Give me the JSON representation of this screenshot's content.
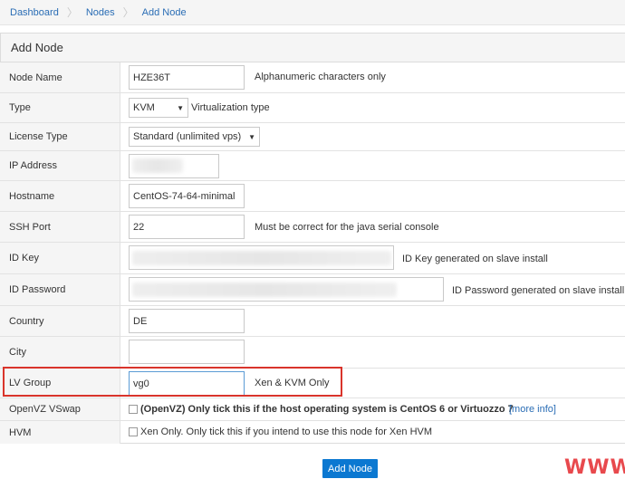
{
  "breadcrumb": [
    "Dashboard",
    "Nodes",
    "Add Node"
  ],
  "panel_title": "Add Node",
  "fields": {
    "node_name": {
      "label": "Node Name",
      "value": "HZE36T",
      "hint": "Alphanumeric characters only"
    },
    "type": {
      "label": "Type",
      "value": "KVM",
      "hint": "Virtualization type"
    },
    "license_type": {
      "label": "License Type",
      "value": "Standard (unlimited vps)"
    },
    "ip_address": {
      "label": "IP Address",
      "value": ""
    },
    "hostname": {
      "label": "Hostname",
      "value": "CentOS-74-64-minimal"
    },
    "ssh_port": {
      "label": "SSH Port",
      "value": "22",
      "hint": "Must be correct for the java serial console"
    },
    "id_key": {
      "label": "ID Key",
      "value": "",
      "hint": "ID Key generated on slave install"
    },
    "id_password": {
      "label": "ID Password",
      "value": "",
      "hint": "ID Password generated on slave install"
    },
    "country": {
      "label": "Country",
      "value": "DE"
    },
    "city": {
      "label": "City",
      "value": ""
    },
    "lv_group": {
      "label": "LV Group",
      "value": "vg0",
      "hint": "Xen & KVM Only"
    },
    "openvz_vswap": {
      "label": "OpenVZ VSwap",
      "text": "(OpenVZ) Only tick this if the host operating system is CentOS 6 or Virtuozzo 7",
      "link": "[more info]"
    },
    "hvm": {
      "label": "HVM",
      "text": "Xen Only. Only tick this if you intend to use this node for Xen HVM"
    }
  },
  "submit_label": "Add Node",
  "watermark": "WWW.‘",
  "colors": {
    "link": "#2a6db5",
    "primary_button": "#0b78d1",
    "highlight": "#d9342b"
  }
}
